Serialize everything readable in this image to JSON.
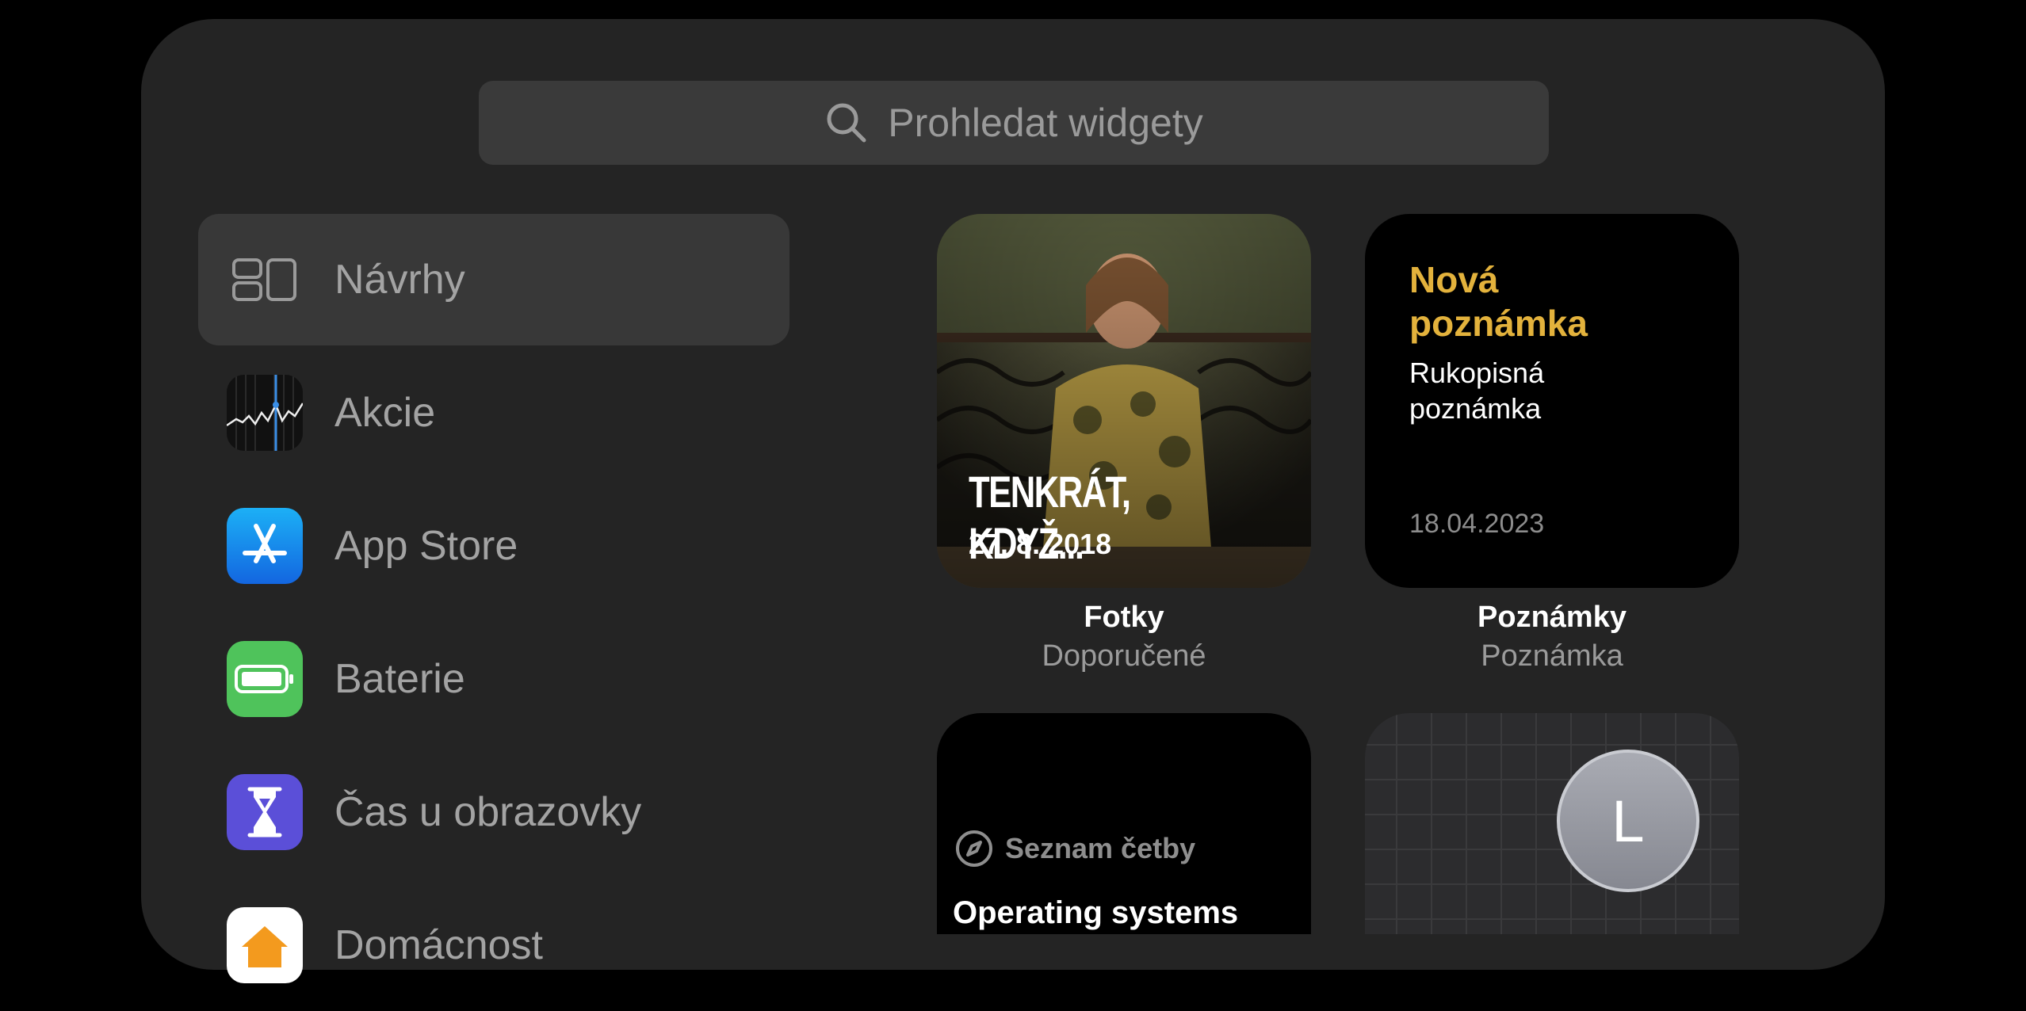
{
  "search": {
    "placeholder": "Prohledat widgety"
  },
  "sidebar": {
    "items": [
      {
        "label": "Návrhy",
        "icon": "widgets-layout-icon",
        "selected": true
      },
      {
        "label": "Akcie",
        "icon": "stocks-app-icon"
      },
      {
        "label": "App Store",
        "icon": "app-store-icon"
      },
      {
        "label": "Baterie",
        "icon": "battery-app-icon"
      },
      {
        "label": "Čas u obrazovky",
        "icon": "screen-time-icon"
      },
      {
        "label": "Domácnost",
        "icon": "home-app-icon"
      }
    ]
  },
  "widgets": [
    {
      "app": "Fotky",
      "kind": "Doporučené",
      "title": "TENKRÁT, KDYŽ...",
      "date": "27. 8. 2018"
    },
    {
      "app": "Poznámky",
      "kind": "Poznámka",
      "title": "Nová poznámka",
      "body": "Rukopisná poznámka",
      "date": "18.04.2023",
      "accent": "#E3B23C"
    },
    {
      "source_label": "Seznam četby",
      "title": "Operating systems"
    },
    {
      "avatar_letter": "L"
    }
  ],
  "colors": {
    "background": "#000000",
    "panel": "#242424",
    "selected": "#383838",
    "notes_accent": "#E3B23C"
  }
}
